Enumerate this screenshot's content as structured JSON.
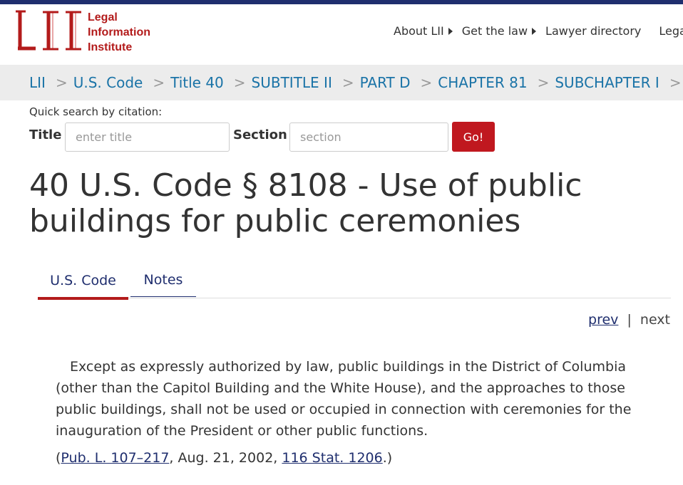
{
  "header": {
    "logo_line1": "Legal",
    "logo_line2": "Information",
    "logo_line3": "Institute",
    "logo_mark_text": "LII",
    "brand_color": "#b31b1b",
    "nav": [
      {
        "label": "About LII",
        "has_caret": true
      },
      {
        "label": "Get the law",
        "has_caret": true
      },
      {
        "label": "Lawyer directory",
        "has_caret": false
      },
      {
        "label": "Legal",
        "has_caret": false
      }
    ]
  },
  "breadcrumb": [
    "LII",
    "U.S. Code",
    "Title 40",
    "SUBTITLE II",
    "PART D",
    "CHAPTER 81",
    "SUBCHAPTER I"
  ],
  "breadcrumb_separator": ">",
  "quick_search": {
    "label": "Quick search by citation:",
    "title_label": "Title",
    "title_placeholder": "enter title",
    "section_label": "Section",
    "section_placeholder": "section",
    "go_label": "Go!"
  },
  "page_title": "40 U.S. Code § 8108 - Use of public buildings for public ceremonies",
  "tabs": [
    {
      "label": "U.S. Code",
      "active": true
    },
    {
      "label": "Notes",
      "active": false
    }
  ],
  "pager": {
    "prev": "prev",
    "divider": "|",
    "next": "next"
  },
  "body_text": "Except as expressly authorized by law, public buildings in the District of Columbia (other than the Capitol Building and the White House), and the approaches to those public buildings, shall not be used or occupied in connection with ceremonies for the inauguration of the President or other public functions.",
  "citation": {
    "open": "(",
    "link1": "Pub. L. 107–217",
    "middle": ", Aug. 21, 2002, ",
    "link2": "116 Stat. 1206",
    "close": ".)"
  },
  "colors": {
    "link": "#1a73a7",
    "nav_blue": "#1f2e6e",
    "go_button": "#c0181f",
    "breadcrumb_bg": "#ececec"
  }
}
